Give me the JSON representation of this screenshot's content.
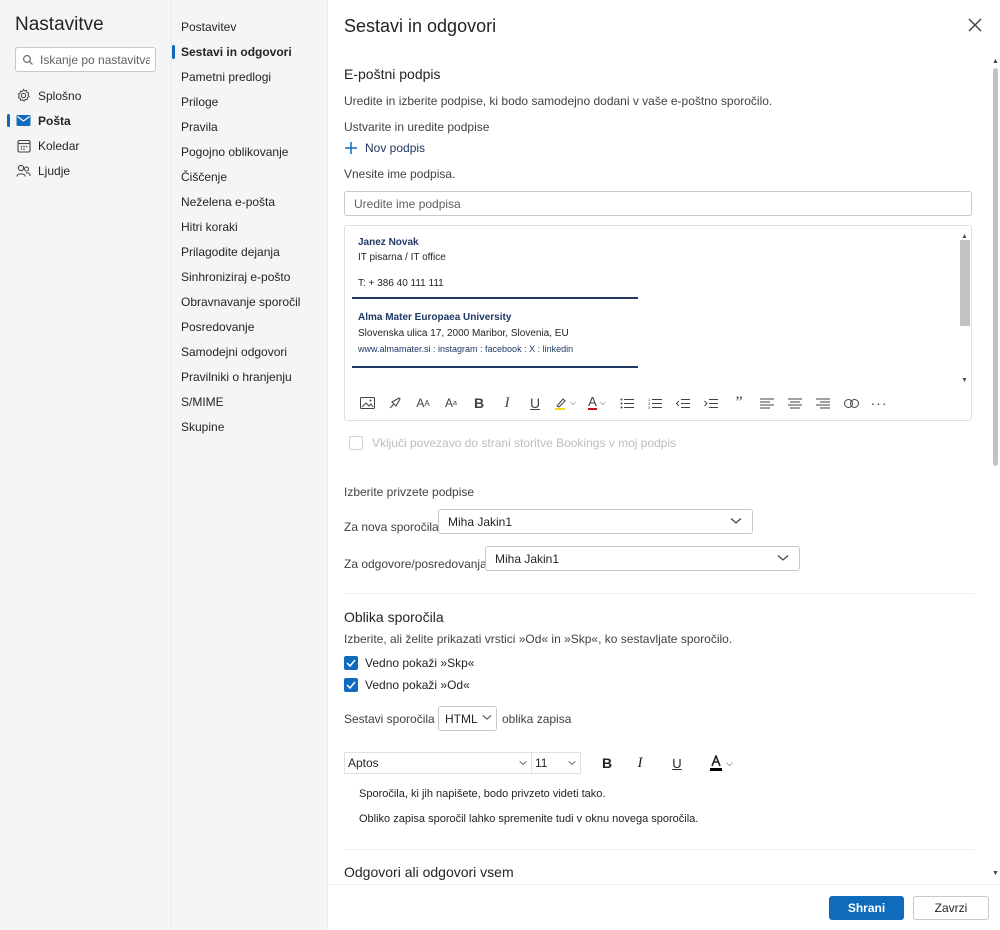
{
  "settings": {
    "title": "Nastavitve",
    "search_placeholder": "Iskanje po nastavitval",
    "nav": [
      {
        "label": "Splošno",
        "icon": "gear-icon"
      },
      {
        "label": "Pošta",
        "icon": "mail-icon"
      },
      {
        "label": "Koledar",
        "icon": "calendar-icon"
      },
      {
        "label": "Ljudje",
        "icon": "people-icon"
      }
    ]
  },
  "mail_sections": [
    "Postavitev",
    "Sestavi in odgovori",
    "Pametni predlogi",
    "Priloge",
    "Pravila",
    "Pogojno oblikovanje",
    "Čiščenje",
    "Neželena e-pošta",
    "Hitri koraki",
    "Prilagodite dejanja",
    "Sinhroniziraj e-pošto",
    "Obravnavanje sporočil",
    "Posredovanje",
    "Samodejni odgovori",
    "Pravilniki o hranjenju",
    "S/MIME",
    "Skupine"
  ],
  "panel": {
    "title": "Sestavi in odgovori",
    "signature": {
      "heading": "E-poštni podpis",
      "description": "Uredite in izberite podpise, ki bodo samodejno dodani v vaše e-poštno sporočilo.",
      "create_label": "Ustvarite in uredite podpise",
      "new_signature": "Nov podpis",
      "name_prompt": "Vnesite ime podpisa.",
      "name_placeholder": "Uredite ime podpisa",
      "content": {
        "name": "Janez Novak",
        "office": "IT pisarna / IT office",
        "phone": "T: + 386 40 111 111",
        "university": "Alma Mater Europaea University",
        "address": "Slovenska ulica 17, 2000 Maribor, Slovenia, EU",
        "links": "www.almamater.si : instagram : facebook : X : linkedin"
      },
      "bookings_label": "Vključi povezavo do strani storitve Bookings v moj podpis"
    },
    "defaults": {
      "heading": "Izberite privzete podpise",
      "new_messages_label": "Za nova sporočila:",
      "new_messages_value": "Miha Jakin1",
      "replies_label": "Za odgovore/posredovanja:",
      "replies_value": "Miha Jakin1"
    },
    "format": {
      "heading": "Oblika sporočila",
      "description": "Izberite, ali želite prikazati vrstici »Od« in »Skp«, ko sestavljate sporočilo.",
      "always_bcc": "Vedno pokaži »Skp«",
      "always_from": "Vedno pokaži »Od«",
      "compose_prefix": "Sestavi sporočila v",
      "compose_format": "HTML",
      "compose_suffix": "oblika zapisa",
      "font_name": "Aptos",
      "font_size": "11",
      "preview_line1": "Sporočila, ki jih napišete, bodo privzeto videti tako.",
      "preview_line2": "Obliko zapisa sporočil lahko spremenite tudi v oknu novega sporočila."
    },
    "reply": {
      "heading": "Odgovori ali odgovori vsem"
    },
    "buttons": {
      "save": "Shrani",
      "discard": "Zavrzi"
    }
  },
  "colors": {
    "accent": "#0f6cbd",
    "signature_blue": "#1f3864",
    "highlight_yellow": "#f5d90a",
    "font_red": "#c50f1f"
  }
}
